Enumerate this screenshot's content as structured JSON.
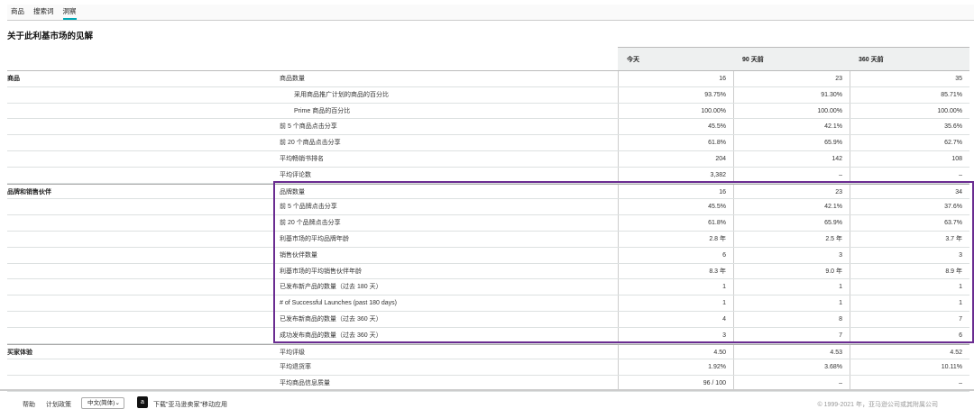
{
  "tabs": [
    "商品",
    "搜索词",
    "洞察"
  ],
  "title": "关于此利基市场的见解",
  "columns": [
    "今天",
    "90 天前",
    "360 天前"
  ],
  "groups": [
    {
      "name": "商品",
      "rows": [
        {
          "label": "商品数量",
          "indent": false,
          "values": [
            "16",
            "23",
            "35"
          ]
        },
        {
          "label": "采用商品推广计划的商品的百分比",
          "indent": true,
          "values": [
            "93.75%",
            "91.30%",
            "85.71%"
          ]
        },
        {
          "label": "Prime 商品的百分比",
          "indent": true,
          "values": [
            "100.00%",
            "100.00%",
            "100.00%"
          ]
        },
        {
          "label": "前 5 个商品点击分享",
          "indent": false,
          "values": [
            "45.5%",
            "42.1%",
            "35.6%"
          ]
        },
        {
          "label": "前 20 个商品点击分享",
          "indent": false,
          "values": [
            "61.8%",
            "65.9%",
            "62.7%"
          ]
        },
        {
          "label": "平均畅销书排名",
          "indent": false,
          "values": [
            "204",
            "142",
            "108"
          ]
        },
        {
          "label": "平均评论数",
          "indent": false,
          "values": [
            "3,382",
            "–",
            "–"
          ]
        }
      ]
    },
    {
      "name": "品牌和销售伙伴",
      "rows": [
        {
          "label": "品牌数量",
          "indent": false,
          "values": [
            "16",
            "23",
            "34"
          ]
        },
        {
          "label": "前 5 个品牌点击分享",
          "indent": false,
          "values": [
            "45.5%",
            "42.1%",
            "37.6%"
          ]
        },
        {
          "label": "前 20 个品牌点击分享",
          "indent": false,
          "values": [
            "61.8%",
            "65.9%",
            "63.7%"
          ]
        },
        {
          "label": "利基市场的平均品牌年龄",
          "indent": false,
          "values": [
            "2.8 年",
            "2.5 年",
            "3.7 年"
          ]
        },
        {
          "label": "销售伙伴数量",
          "indent": false,
          "values": [
            "6",
            "3",
            "3"
          ]
        },
        {
          "label": "利基市场的平均销售伙伴年龄",
          "indent": false,
          "values": [
            "8.3 年",
            "9.0 年",
            "8.9 年"
          ]
        },
        {
          "label": "已发布新产品的数量（过去 180 天）",
          "indent": false,
          "values": [
            "1",
            "1",
            "1"
          ]
        },
        {
          "label": "# of Successful Launches (past 180 days)",
          "indent": false,
          "values": [
            "1",
            "1",
            "1"
          ]
        },
        {
          "label": "已发布新商品的数量（过去 360 天）",
          "indent": false,
          "values": [
            "4",
            "8",
            "7"
          ]
        },
        {
          "label": "成功发布商品的数量（过去 360 天）",
          "indent": false,
          "values": [
            "3",
            "7",
            "6"
          ]
        }
      ]
    },
    {
      "name": "买家体验",
      "rows": [
        {
          "label": "平均评级",
          "indent": false,
          "values": [
            "4.50",
            "4.53",
            "4.52"
          ]
        },
        {
          "label": "平均退货率",
          "indent": false,
          "values": [
            "1.92%",
            "3.68%",
            "10.11%"
          ]
        },
        {
          "label": "平均商品信息质量",
          "indent": false,
          "values": [
            "96 / 100",
            "–",
            "–"
          ]
        }
      ]
    }
  ],
  "footer": {
    "help": "帮助",
    "policy": "计划政策",
    "language": "中文(简体)",
    "app_download": "下载\"亚马逊卖家\"移动应用",
    "copyright": "© 1999-2021 年，亚马逊公司或其附属公司"
  },
  "colors": {
    "accent": "#00a8b5",
    "highlight": "#6a2c91"
  }
}
